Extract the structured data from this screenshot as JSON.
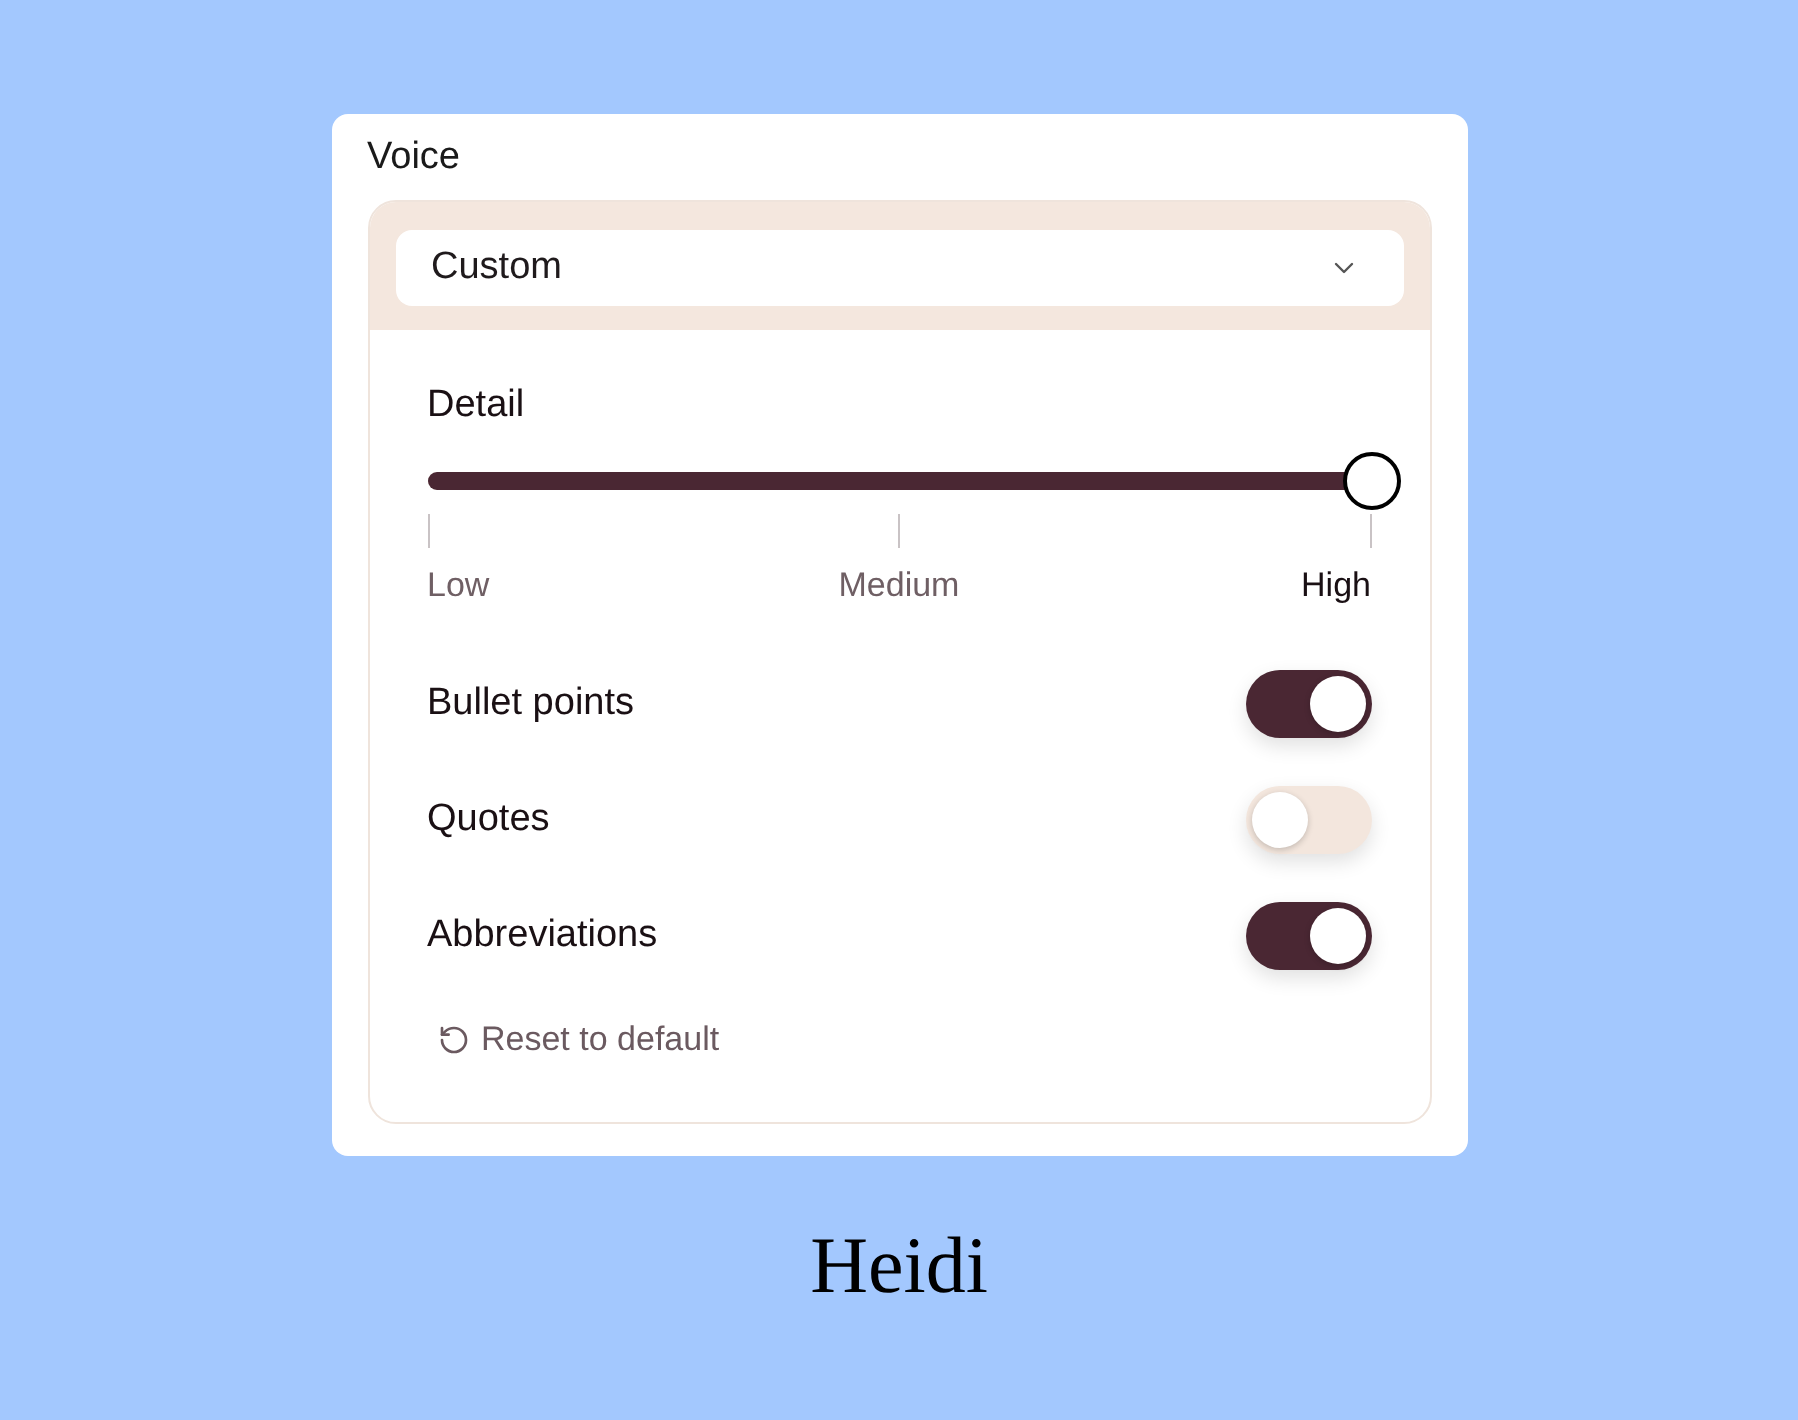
{
  "section": {
    "title": "Voice"
  },
  "preset_select": {
    "value": "Custom"
  },
  "detail": {
    "label": "Detail",
    "level": 1,
    "ticks": [
      {
        "label": "Low",
        "selected": false
      },
      {
        "label": "Medium",
        "selected": false
      },
      {
        "label": "High",
        "selected": true
      }
    ]
  },
  "toggles": [
    {
      "label": "Bullet points",
      "on": true
    },
    {
      "label": "Quotes",
      "on": false
    },
    {
      "label": "Abbreviations",
      "on": true
    }
  ],
  "reset_button": {
    "label": "Reset to default"
  },
  "caption": "Heidi"
}
